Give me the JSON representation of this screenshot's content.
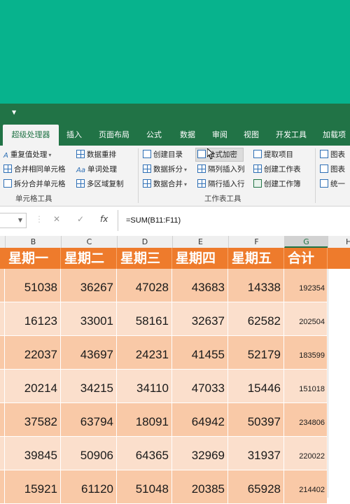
{
  "tabs": [
    "超级处理器",
    "插入",
    "页面布局",
    "公式",
    "数据",
    "审阅",
    "视图",
    "开发工具",
    "加载项"
  ],
  "ribbon": {
    "group1": {
      "items": [
        "重复值处理",
        "数据重排",
        "合并相同单元格",
        "单词处理",
        "拆分合并单元格",
        "多区域复制"
      ],
      "label": "单元格工具"
    },
    "group2": {
      "items": [
        "创建目录",
        "公式加密",
        "提取项目",
        "数据拆分",
        "隔列插入列",
        "创建工作表",
        "数据合并",
        "隔行插入行",
        "创建工作簿"
      ],
      "label": "工作表工具"
    },
    "group3": {
      "items": [
        "图表",
        "图表",
        "统一"
      ]
    },
    "word_icon_text": "Aa"
  },
  "formula_bar": {
    "cancel": "✕",
    "enter": "✓",
    "fx": "fx",
    "formula": "=SUM(B11:F11)"
  },
  "columns": [
    "B",
    "C",
    "D",
    "E",
    "F",
    "G",
    "H"
  ],
  "table": {
    "headers": [
      "星期一",
      "星期二",
      "星期三",
      "星期四",
      "星期五",
      "合计"
    ],
    "rows": [
      [
        "51038",
        "36267",
        "47028",
        "43683",
        "14338",
        "192354"
      ],
      [
        "16123",
        "33001",
        "58161",
        "32637",
        "62582",
        "202504"
      ],
      [
        "22037",
        "43697",
        "24231",
        "41455",
        "52179",
        "183599"
      ],
      [
        "20214",
        "34215",
        "34110",
        "47033",
        "15446",
        "151018"
      ],
      [
        "37582",
        "63794",
        "18091",
        "64942",
        "50397",
        "234806"
      ],
      [
        "39845",
        "50906",
        "64365",
        "32969",
        "31937",
        "220022"
      ],
      [
        "15921",
        "61120",
        "51048",
        "20385",
        "65928",
        "214402"
      ]
    ]
  },
  "colors": {
    "header": "#ee7b2c",
    "row_dark": "#f9c9a7",
    "row_light": "#fbdfcc",
    "ribbon_green": "#217346",
    "background": "#07b38d"
  }
}
